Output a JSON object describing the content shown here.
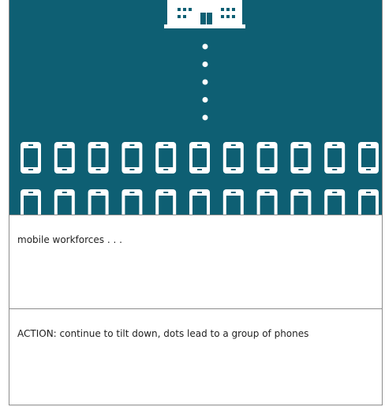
{
  "scene": {
    "background_color": "#0e5f73",
    "foreground_color": "#ffffff",
    "icons": {
      "building": "office-building-icon",
      "dot": "dot-icon",
      "phone": "smartphone-icon"
    },
    "dot_count": 5,
    "phones_per_row": 11,
    "phone_rows": 2
  },
  "caption": {
    "text": "mobile workforces . . ."
  },
  "action": {
    "text": "ACTION: continue to tilt down, dots lead to a group of phones"
  }
}
